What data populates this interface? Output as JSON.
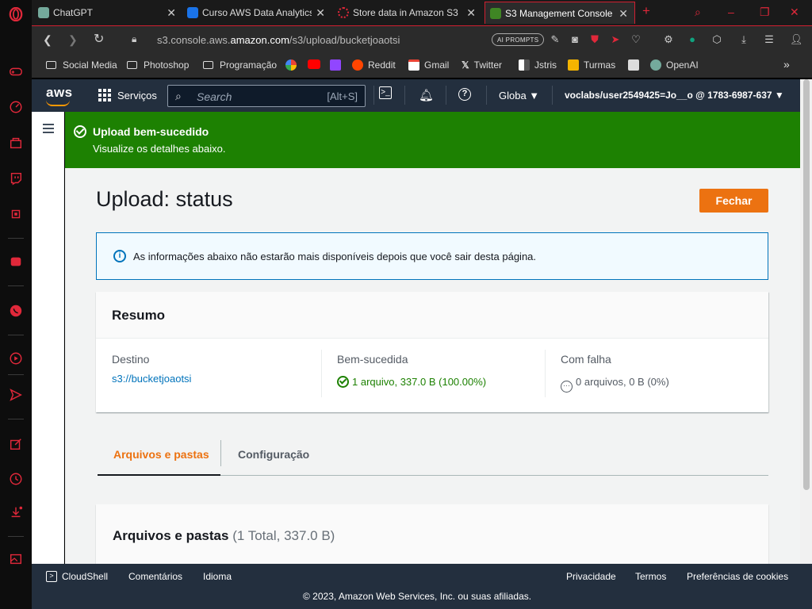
{
  "browser": {
    "tabs": [
      {
        "title": "ChatGPT",
        "color": "#74aa9c"
      },
      {
        "title": "Curso AWS Data Analytics",
        "color": "#1a73e8"
      },
      {
        "title": "Store data in Amazon S3",
        "color": "#e0283a"
      },
      {
        "title": "S3 Management Console",
        "color": "#3f8624"
      }
    ],
    "url_prefix": "s3.console.aws.",
    "url_domain": "amazon.com",
    "url_path": "/s3/upload/bucketjoaotsi",
    "ai_prompts_label": "AI PROMPTS",
    "bookmarks": [
      "Social Media",
      "Photoshop",
      "Programação",
      "Reddit",
      "Gmail",
      "Twitter",
      "Jstris",
      "Turmas",
      "OpenAI"
    ]
  },
  "aws_header": {
    "logo": "aws",
    "services_label": "Serviços",
    "search_placeholder": "Search",
    "search_shortcut": "[Alt+S]",
    "region": "Globa ▼",
    "account": "voclabs/user2549425=Jo__o @ 1783-6987-637 ▼"
  },
  "flash": {
    "title": "Upload bem-sucedido",
    "subtitle": "Visualize os detalhes abaixo."
  },
  "page": {
    "title": "Upload: status",
    "close_label": "Fechar",
    "info_text": "As informações abaixo não estarão mais disponíveis depois que você sair desta página."
  },
  "summary": {
    "heading": "Resumo",
    "dest_label": "Destino",
    "dest_value": "s3://bucketjoaotsi",
    "success_label": "Bem-sucedida",
    "success_value": "1 arquivo, 337.0 B (100.00%)",
    "failed_label": "Com falha",
    "failed_value": "0 arquivos, 0 B (0%)"
  },
  "tabs": {
    "files": "Arquivos e pastas",
    "config": "Configuração"
  },
  "files_card": {
    "title": "Arquivos e pastas",
    "count": "(1 Total, 337.0 B)"
  },
  "footer": {
    "cloudshell": "CloudShell",
    "comments": "Comentários",
    "language": "Idioma",
    "privacy": "Privacidade",
    "terms": "Termos",
    "cookies": "Preferências de cookies",
    "copyright": "© 2023, Amazon Web Services, Inc. ou suas afiliadas."
  }
}
